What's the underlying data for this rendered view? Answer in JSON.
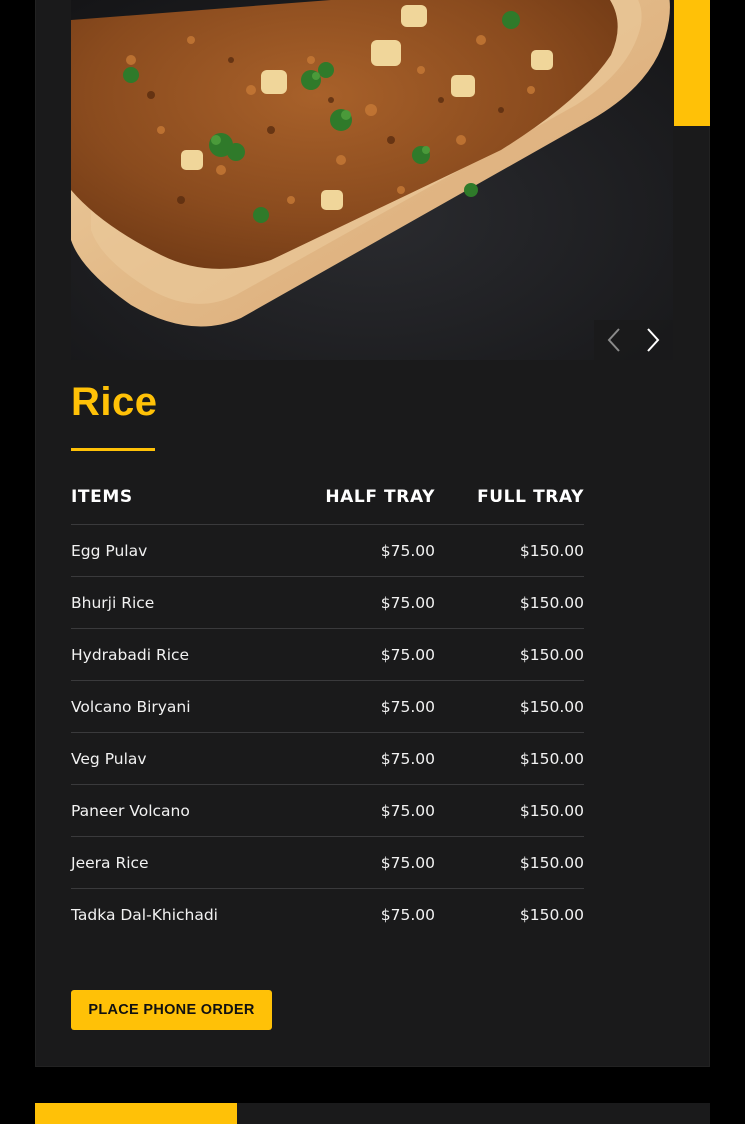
{
  "section": {
    "title": "Rice"
  },
  "slider": {
    "prev_icon": "chevron-left-icon",
    "next_icon": "chevron-right-icon"
  },
  "menu_table": {
    "headers": {
      "item": "ITEMS",
      "half": "HALF TRAY",
      "full": "FULL TRAY"
    },
    "rows": [
      {
        "item": "Egg Pulav",
        "half": "$75.00",
        "full": "$150.00"
      },
      {
        "item": "Bhurji Rice",
        "half": "$75.00",
        "full": "$150.00"
      },
      {
        "item": "Hydrabadi Rice",
        "half": "$75.00",
        "full": "$150.00"
      },
      {
        "item": "Volcano Biryani",
        "half": "$75.00",
        "full": "$150.00"
      },
      {
        "item": "Veg Pulav",
        "half": "$75.00",
        "full": "$150.00"
      },
      {
        "item": "Paneer Volcano",
        "half": "$75.00",
        "full": "$150.00"
      },
      {
        "item": "Jeera Rice",
        "half": "$75.00",
        "full": "$150.00"
      },
      {
        "item": "Tadka Dal-Khichadi",
        "half": "$75.00",
        "full": "$150.00"
      }
    ]
  },
  "actions": {
    "order_label": "PLACE PHONE ORDER"
  },
  "colors": {
    "accent": "#ffc107",
    "card_bg": "#1a1a1b",
    "page_bg": "#000000"
  }
}
